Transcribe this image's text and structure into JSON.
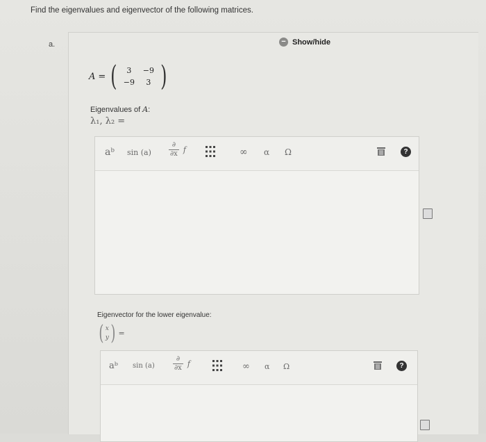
{
  "header": {
    "text": "Find the eigenvalues and eigenvector of the following matrices."
  },
  "part": {
    "label": "a."
  },
  "showhide": {
    "icon": "minus-circle-icon",
    "label": "Show/hide"
  },
  "matrix": {
    "symbol": "A",
    "equals": "=",
    "rows": [
      [
        "3",
        "−9"
      ],
      [
        "−9",
        "3"
      ]
    ]
  },
  "eigenvalues": {
    "label_text": "Eigenvalues of ",
    "label_var": "A",
    "label_colon": ":",
    "lambda": "λ₁, λ₂ ="
  },
  "toolbar": {
    "power": "aᵇ",
    "sin": "sin (a)",
    "deriv_num": "∂",
    "deriv_den": "∂x",
    "deriv_f": "f",
    "matrix_icon": "matrix-grid-icon",
    "infinity": "∞",
    "alpha": "α",
    "omega": "Ω",
    "trash_icon": "trash-icon",
    "help": "?"
  },
  "eigenvector": {
    "label": "Eigenvector for the lower eigenvalue:",
    "x": "x",
    "y": "y",
    "equals": "="
  },
  "colors": {
    "background": "#e2e2de",
    "editor": "#efefec",
    "help": "#333333"
  }
}
